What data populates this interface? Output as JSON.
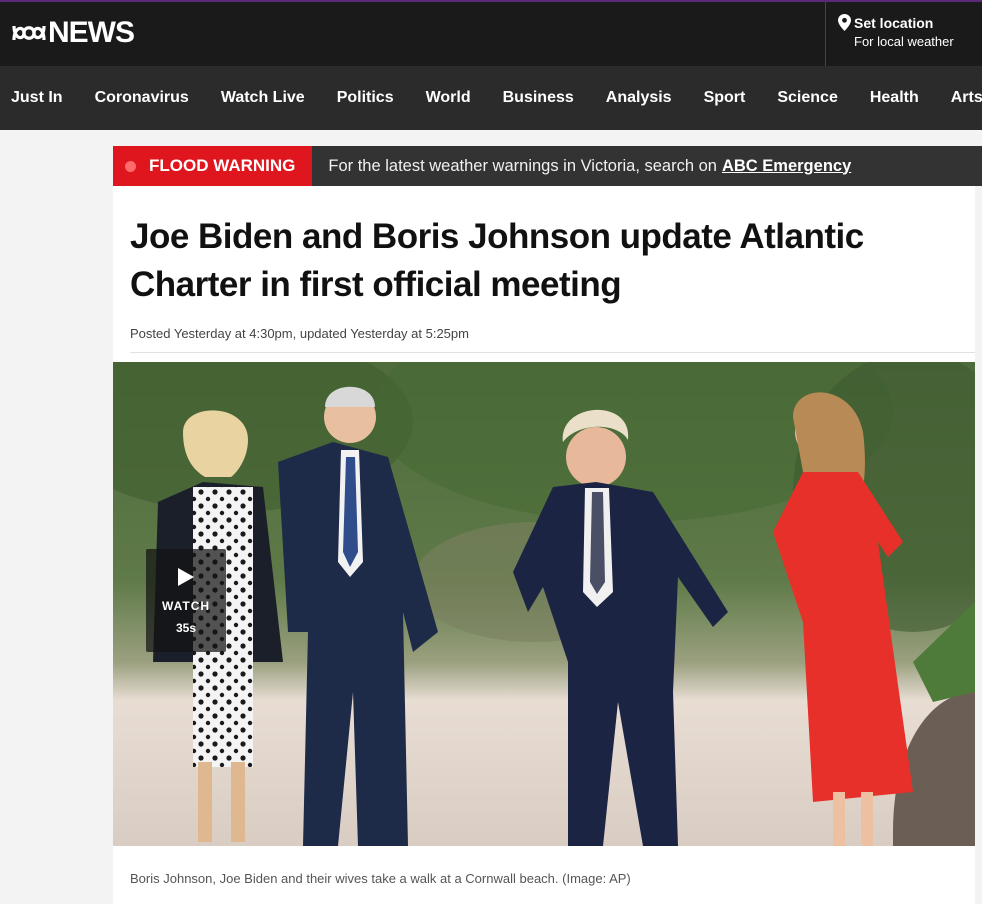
{
  "header": {
    "logo_text": "NEWS",
    "location_title": "Set location",
    "location_subtitle": "For local weather"
  },
  "nav": {
    "items": [
      {
        "label": "Just In"
      },
      {
        "label": "Coronavirus"
      },
      {
        "label": "Watch Live"
      },
      {
        "label": "Politics"
      },
      {
        "label": "World"
      },
      {
        "label": "Business"
      },
      {
        "label": "Analysis"
      },
      {
        "label": "Sport"
      },
      {
        "label": "Science"
      },
      {
        "label": "Health"
      },
      {
        "label": "Arts"
      }
    ]
  },
  "alert": {
    "tag": "FLOOD WARNING",
    "message": "For the latest weather warnings in Victoria, search on",
    "link_text": "ABC Emergency",
    "tag_color": "#e0161e"
  },
  "article": {
    "headline": "Joe Biden and Boris Johnson update Atlantic Charter in first official meeting",
    "dateline": "Posted Yesterday at 4:30pm, updated Yesterday at 5:25pm",
    "caption": "Boris Johnson, Joe Biden and their wives take a walk at a Cornwall beach. (Image: AP)",
    "video": {
      "label": "WATCH",
      "duration": "35s"
    }
  }
}
